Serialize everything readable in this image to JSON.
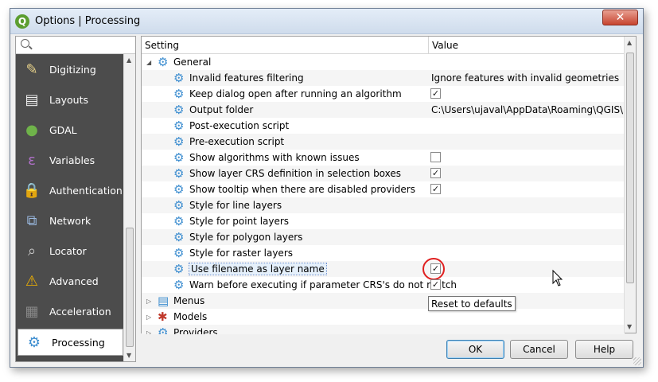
{
  "window": {
    "title": "Options | Processing",
    "app_icon": "Q",
    "close_glyph": "✕"
  },
  "sidebar": {
    "search_placeholder": "",
    "items": [
      {
        "label": "Digitizing",
        "icon": "digitizing-icon"
      },
      {
        "label": "Layouts",
        "icon": "layouts-icon"
      },
      {
        "label": "GDAL",
        "icon": "gdal-icon"
      },
      {
        "label": "Variables",
        "icon": "variables-icon"
      },
      {
        "label": "Authentication",
        "icon": "lock-icon"
      },
      {
        "label": "Network",
        "icon": "network-icon"
      },
      {
        "label": "Locator",
        "icon": "search-icon"
      },
      {
        "label": "Advanced",
        "icon": "warning-icon"
      },
      {
        "label": "Acceleration",
        "icon": "chip-icon"
      },
      {
        "label": "Processing",
        "icon": "gear-icon",
        "active": true
      }
    ]
  },
  "table": {
    "col_setting": "Setting",
    "col_value": "Value",
    "rows": [
      {
        "label": "General",
        "level": 0,
        "expander": "◢",
        "value": ""
      },
      {
        "label": "Invalid features filtering",
        "level": 1,
        "value": "Ignore features with invalid geometries"
      },
      {
        "label": "Keep dialog open after running an algorithm",
        "level": 1,
        "checkbox": "✓"
      },
      {
        "label": "Output folder",
        "level": 1,
        "value": "C:\\Users\\ujaval\\AppData\\Roaming\\QGIS\\..."
      },
      {
        "label": "Post-execution script",
        "level": 1,
        "value": ""
      },
      {
        "label": "Pre-execution script",
        "level": 1,
        "value": ""
      },
      {
        "label": "Show algorithms with known issues",
        "level": 1,
        "checkbox": ""
      },
      {
        "label": "Show layer CRS definition in selection boxes",
        "level": 1,
        "checkbox": "✓"
      },
      {
        "label": "Show tooltip when there are disabled providers",
        "level": 1,
        "checkbox": "✓"
      },
      {
        "label": "Style for line layers",
        "level": 1,
        "value": ""
      },
      {
        "label": "Style for point layers",
        "level": 1,
        "value": ""
      },
      {
        "label": "Style for polygon layers",
        "level": 1,
        "value": ""
      },
      {
        "label": "Style for raster layers",
        "level": 1,
        "value": ""
      },
      {
        "label": "Use filename as layer name",
        "level": 1,
        "checkbox": "✓",
        "selected": true
      },
      {
        "label": "Warn before executing if parameter CRS's do not match",
        "level": 1,
        "checkbox": "✓"
      },
      {
        "label": "Menus",
        "level": 0,
        "expander": "▷",
        "value": ""
      },
      {
        "label": "Models",
        "level": 0,
        "expander": "▷",
        "value": ""
      },
      {
        "label": "Providers",
        "level": 0,
        "expander": "▷",
        "value": ""
      }
    ]
  },
  "tooltip": "Reset to defaults",
  "buttons": {
    "ok": "OK",
    "cancel": "Cancel",
    "help": "Help"
  }
}
